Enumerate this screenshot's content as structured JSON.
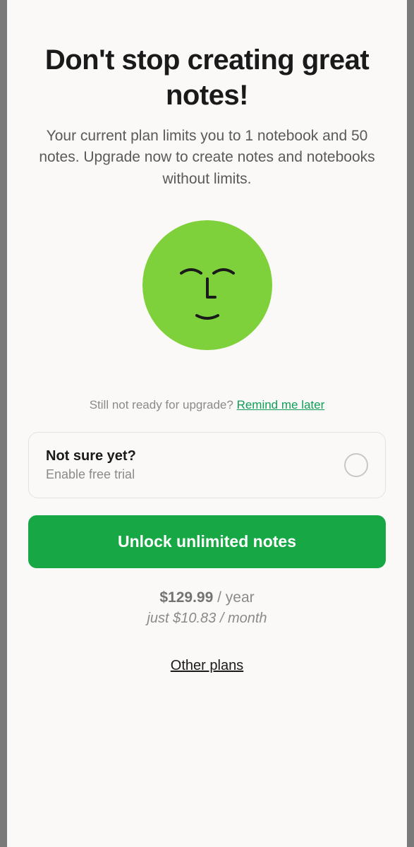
{
  "modal": {
    "title": "Don't stop creating great notes!",
    "subtitle": "Your current plan limits you to 1 notebook and 50 notes. Upgrade now to create notes and notebooks without limits.",
    "remind_prefix": "Still not ready for upgrade? ",
    "remind_link": "Remind me later",
    "trial": {
      "heading": "Not sure yet?",
      "sub": "Enable free trial"
    },
    "cta_label": "Unlock unlimited notes",
    "price_amount": "$129.99",
    "price_period": " / year",
    "monthly_hint": "just $10.83 / month",
    "other_plans": "Other plans"
  },
  "colors": {
    "accent_green": "#17a744",
    "link_green": "#0f9d58",
    "face_green": "#8bc34a"
  }
}
